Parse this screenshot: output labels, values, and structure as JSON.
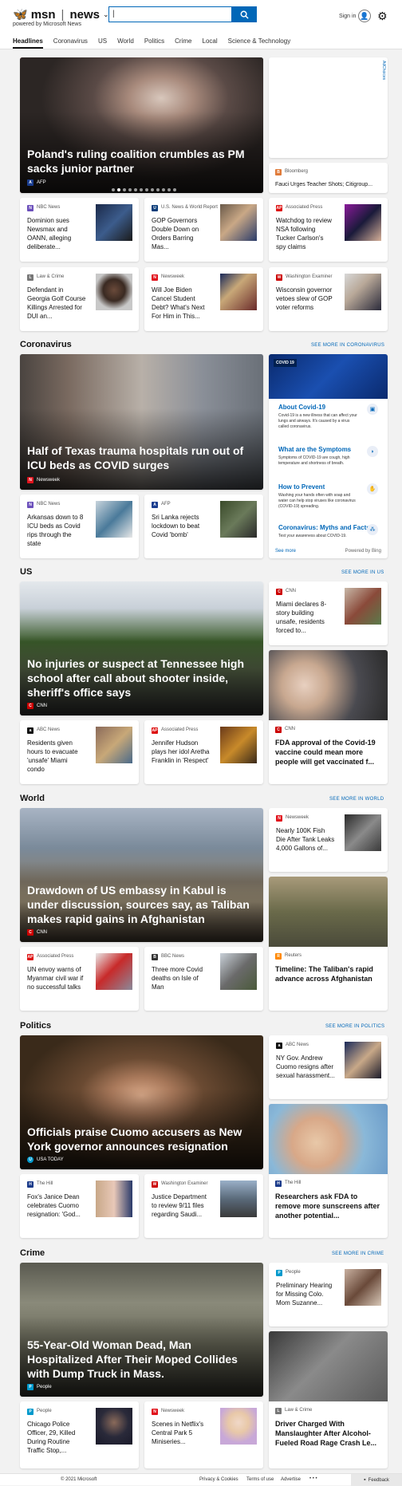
{
  "header": {
    "brand": "msn",
    "section": "news",
    "caret": "⌄",
    "powered_by": "powered by Microsoft News",
    "search_value": "|",
    "sign_in": "Sign in"
  },
  "nav": [
    "Headlines",
    "Coronavirus",
    "US",
    "World",
    "Politics",
    "Crime",
    "Local",
    "Science & Technology"
  ],
  "headlines": {
    "hero": {
      "title": "Poland's ruling coalition crumbles as PM sacks junior partner",
      "source": "AFP"
    },
    "ad": {
      "tag": "AdChoices",
      "source": "Bloomberg",
      "title": "Fauci Urges Teacher Shots; Citigroup..."
    },
    "cards": [
      {
        "source": "NBC News",
        "title": "Dominion sues Newsmax and OANN, alleging deliberate..."
      },
      {
        "source": "U.S. News & World Report",
        "title": "GOP Governors Double Down on Orders Barring Mas..."
      },
      {
        "source": "Associated Press",
        "title": "Watchdog to review NSA following Tucker Carlson's spy claims"
      },
      {
        "source": "Law & Crime",
        "title": "Defendant in Georgia Golf Course Killings Arrested for DUI an..."
      },
      {
        "source": "Newsweek",
        "title": "Will Joe Biden Cancel Student Debt? What's Next For Him in This..."
      },
      {
        "source": "Washington Examiner",
        "title": "Wisconsin governor vetoes slew of GOP voter reforms"
      }
    ]
  },
  "coronavirus": {
    "heading": "Coronavirus",
    "more": "SEE MORE IN CORONAVIRUS",
    "hero": {
      "title": "Half of Texas trauma hospitals run out of ICU beds as COVID surges",
      "source": "Newsweek"
    },
    "cards": [
      {
        "source": "NBC News",
        "title": "Arkansas down to 8 ICU beds as Covid rips through the state"
      },
      {
        "source": "AFP",
        "title": "Sri Lanka rejects lockdown to beat Covid 'bomb'"
      }
    ],
    "panel": {
      "badge": "COVID 19",
      "items": [
        {
          "title": "About Covid-19",
          "desc": "Covid-19 is a new illness that can affect your lungs and airways. It's caused by a virus called coronavirus."
        },
        {
          "title": "What are the Symptoms",
          "desc": "Symptoms of COVID-19 are cough, high temperature and shortness of breath."
        },
        {
          "title": "How to Prevent",
          "desc": "Washing your hands often with soap and water can help stop viruses like coronavirus (COVID-19) spreading."
        },
        {
          "title": "Coronavirus: Myths and Facts",
          "desc": "Test your awareness about COVID-19."
        }
      ],
      "see_more": "See more",
      "powered": "Powered by Bing"
    }
  },
  "us": {
    "heading": "US",
    "more": "SEE MORE IN US",
    "hero": {
      "title": "No injuries or suspect at Tennessee high school after call about shooter inside, sheriff's office says",
      "source": "CNN"
    },
    "right_small": {
      "source": "CNN",
      "title": "Miami declares 8-story building unsafe, residents forced to..."
    },
    "right_tall": {
      "source": "CNN",
      "title": "FDA approval of the Covid-19 vaccine could mean more people will get vaccinated f..."
    },
    "cards": [
      {
        "source": "ABC News",
        "title": "Residents given hours to evacuate 'unsafe' Miami condo"
      },
      {
        "source": "Associated Press",
        "title": "Jennifer Hudson plays her idol Aretha Franklin in 'Respect'"
      }
    ]
  },
  "world": {
    "heading": "World",
    "more": "SEE MORE IN WORLD",
    "hero": {
      "title": "Drawdown of US embassy in Kabul is under discussion, sources say, as Taliban makes rapid gains in Afghanistan",
      "source": "CNN"
    },
    "right_small": {
      "source": "Newsweek",
      "title": "Nearly 100K Fish Die After Tank Leaks 4,000 Gallons of..."
    },
    "right_tall": {
      "source": "Reuters",
      "title": "Timeline: The Taliban's rapid advance across Afghanistan"
    },
    "cards": [
      {
        "source": "Associated Press",
        "title": "UN envoy warns of Myanmar civil war if no successful talks"
      },
      {
        "source": "BBC News",
        "title": "Three more Covid deaths on Isle of Man"
      }
    ]
  },
  "politics": {
    "heading": "Politics",
    "more": "SEE MORE IN POLITICS",
    "hero": {
      "title": "Officials praise Cuomo accusers as New York governor announces resignation",
      "source": "USA TODAY"
    },
    "right_small": {
      "source": "ABC News",
      "title": "NY Gov. Andrew Cuomo resigns after sexual harassment..."
    },
    "right_tall": {
      "source": "The Hill",
      "title": "Researchers ask FDA to remove more sunscreens after another potential..."
    },
    "cards": [
      {
        "source": "The Hill",
        "title": "Fox's Janice Dean celebrates Cuomo resignation: 'God..."
      },
      {
        "source": "Washington Examiner",
        "title": "Justice Department to review 9/11 files regarding Saudi..."
      }
    ]
  },
  "crime": {
    "heading": "Crime",
    "more": "SEE MORE IN CRIME",
    "hero": {
      "title": "55-Year-Old Woman Dead, Man Hospitalized After Their Moped Collides with Dump Truck in Mass.",
      "source": "People"
    },
    "right_small": {
      "source": "People",
      "title": "Preliminary Hearing for Missing Colo. Mom Suzanne..."
    },
    "right_tall": {
      "source": "Law & Crime",
      "title": "Driver Charged With Manslaughter After Alcohol-Fueled Road Rage Crash Le..."
    },
    "cards": [
      {
        "source": "People",
        "title": "Chicago Police Officer, 29, Killed During Routine Traffic Stop,..."
      },
      {
        "source": "Newsweek",
        "title": "Scenes in Netflix's Central Park 5 Miniseries..."
      }
    ]
  },
  "footer": {
    "copyright": "© 2021 Microsoft",
    "privacy": "Privacy & Cookies",
    "terms": "Terms of use",
    "advertise": "Advertise",
    "dots": "• • •",
    "feedback": "Feedback"
  }
}
